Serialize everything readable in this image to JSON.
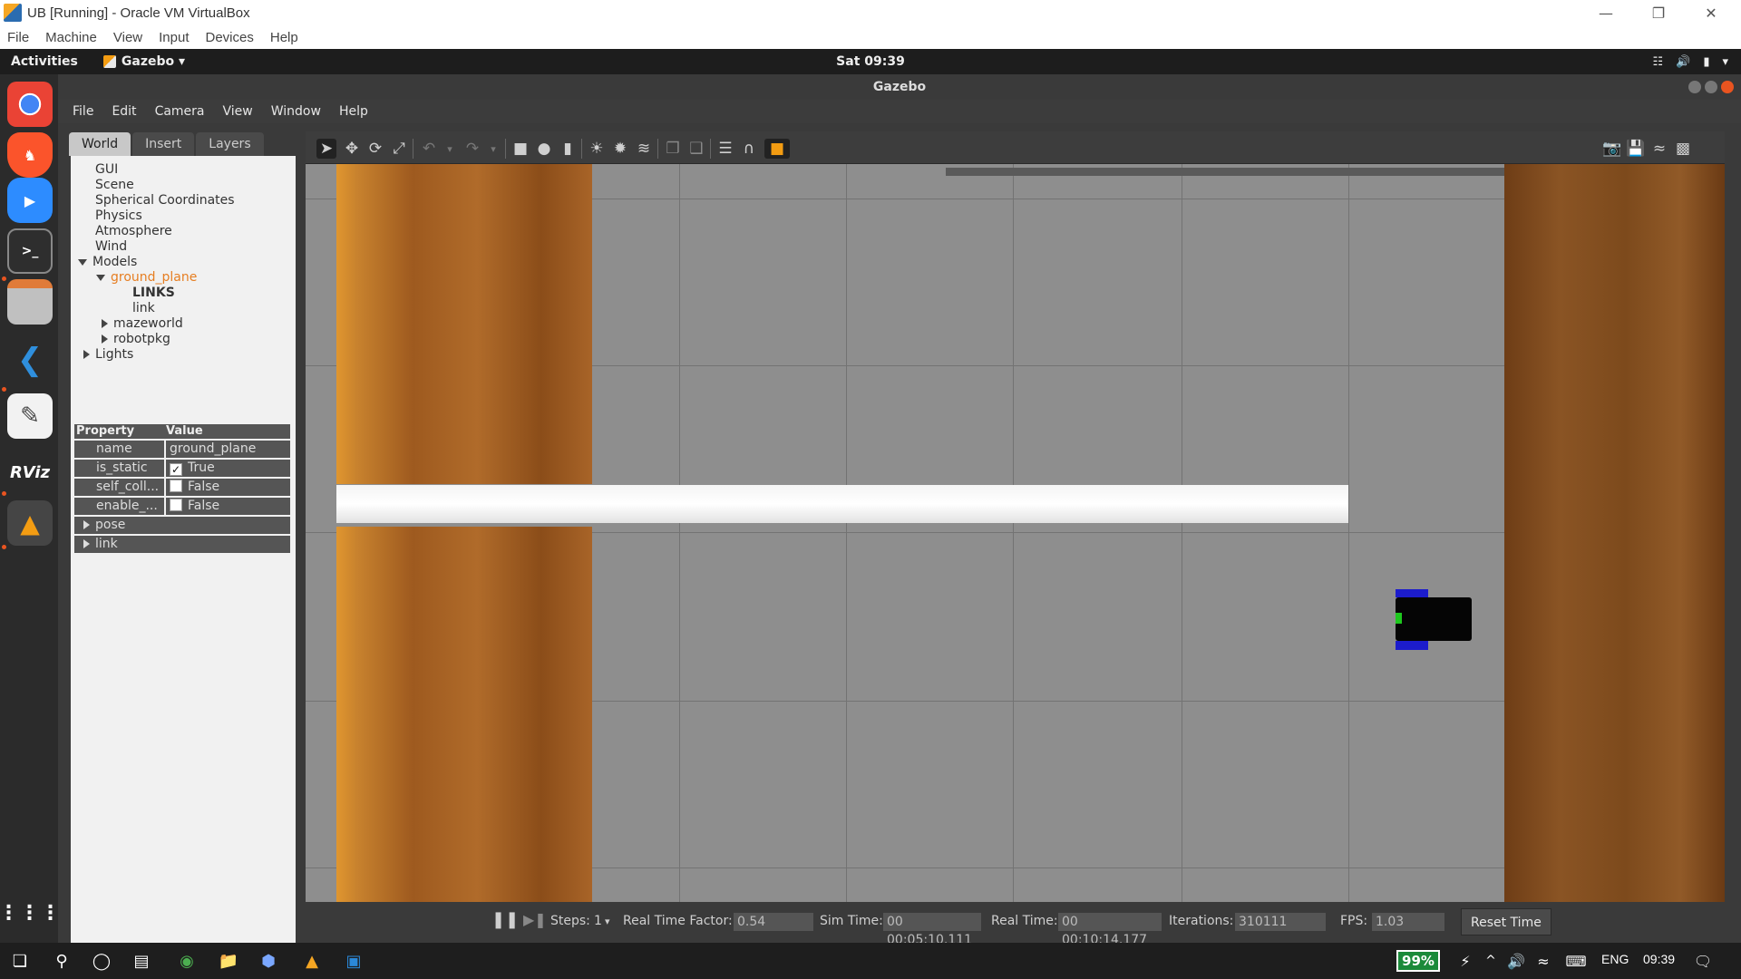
{
  "host_window": {
    "title": "UB [Running] - Oracle VM VirtualBox",
    "menu": [
      "File",
      "Machine",
      "View",
      "Input",
      "Devices",
      "Help"
    ]
  },
  "topbar": {
    "activities": "Activities",
    "app_menu": "Gazebo ▾",
    "clock": "Sat 09:39"
  },
  "dock": {
    "items": [
      "chrome-icon",
      "brave-icon",
      "zoom-icon",
      "terminal-icon",
      "files-icon",
      "vscode-icon",
      "text-editor-icon",
      "rviz-icon",
      "gazebo-icon",
      "show-apps-icon"
    ],
    "rviz_label": "RViz"
  },
  "gazebo": {
    "window_title": "Gazebo",
    "menu": [
      "File",
      "Edit",
      "Camera",
      "View",
      "Window",
      "Help"
    ],
    "tabs": [
      "World",
      "Insert",
      "Layers"
    ],
    "tree": [
      {
        "label": "GUI"
      },
      {
        "label": "Scene"
      },
      {
        "label": "Spherical Coordinates"
      },
      {
        "label": "Physics"
      },
      {
        "label": "Atmosphere"
      },
      {
        "label": "Wind"
      },
      {
        "label": "Models"
      },
      {
        "label": "ground_plane"
      },
      {
        "label": "LINKS"
      },
      {
        "label": "link"
      },
      {
        "label": "mazeworld"
      },
      {
        "label": "robotpkg"
      },
      {
        "label": "Lights"
      }
    ],
    "properties": {
      "header_property": "Property",
      "header_value": "Value",
      "rows": [
        {
          "name": "name",
          "value": "ground_plane"
        },
        {
          "name": "is_static",
          "value": "True",
          "checked": true
        },
        {
          "name": "self_coll...",
          "value": "False",
          "checked": false
        },
        {
          "name": "enable_...",
          "value": "False",
          "checked": false
        }
      ],
      "groups": [
        "pose",
        "link"
      ]
    },
    "status": {
      "steps_label": "Steps:",
      "steps_value": "1",
      "rtf_label": "Real Time Factor:",
      "rtf_value": "0.54",
      "sim_time_label": "Sim Time:",
      "sim_time_value": "00 00:05:10.111",
      "real_time_label": "Real Time:",
      "real_time_value": "00 00:10:14.177",
      "iterations_label": "Iterations:",
      "iterations_value": "310111",
      "fps_label": "FPS:",
      "fps_value": "1.03",
      "reset_label": "Reset Time"
    }
  },
  "taskbar": {
    "battery": "99%",
    "lang": "ENG",
    "time": "09:39"
  },
  "colors": {
    "selected_tree": "#e67e22",
    "accent": "#e95420"
  }
}
